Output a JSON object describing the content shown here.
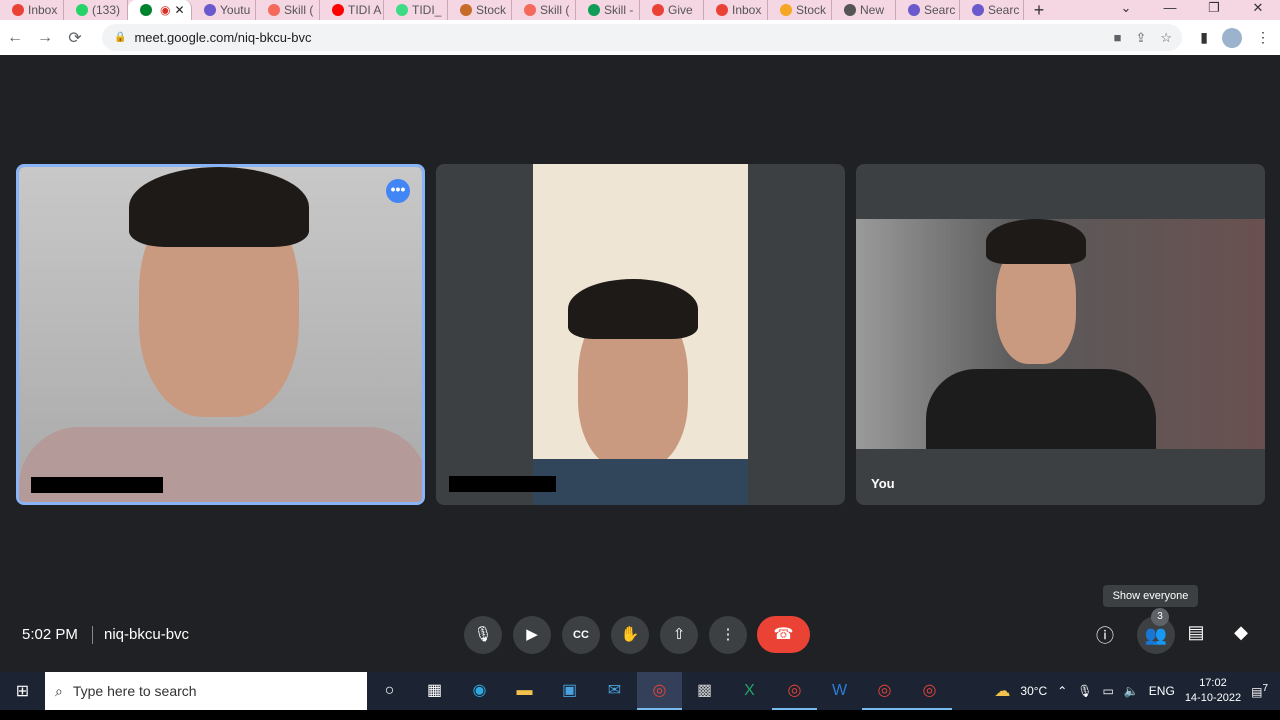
{
  "browser": {
    "tabs": [
      {
        "label": "Inbox",
        "color": "#ea4335"
      },
      {
        "label": "(133)",
        "color": "#25d366"
      },
      {
        "label": "",
        "color": "#00832d",
        "active": true
      },
      {
        "label": "Youtu",
        "color": "#6a5acd"
      },
      {
        "label": "Skill (",
        "color": "#f4695c"
      },
      {
        "label": "TIDI A",
        "color": "#ff0000"
      },
      {
        "label": "TIDI_",
        "color": "#3ddc84"
      },
      {
        "label": "Stock",
        "color": "#c76b29"
      },
      {
        "label": "Skill (",
        "color": "#f4695c"
      },
      {
        "label": "Skill -",
        "color": "#0f9d58"
      },
      {
        "label": "Give",
        "color": "#ea4335"
      },
      {
        "label": "Inbox",
        "color": "#ea4335"
      },
      {
        "label": "Stock",
        "color": "#f5a623"
      },
      {
        "label": "New",
        "color": "#555555"
      },
      {
        "label": "Searc",
        "color": "#6a5acd"
      },
      {
        "label": "Searc",
        "color": "#6a5acd"
      }
    ],
    "url": "meet.google.com/niq-bkcu-bvc"
  },
  "meet": {
    "participants": [
      {
        "name": ""
      },
      {
        "name": ""
      },
      {
        "name": "You"
      }
    ],
    "time": "5:02 PM",
    "meeting_code": "niq-bkcu-bvc",
    "tooltip": "Show everyone",
    "people_count": "3",
    "accent": "#8ab4f8",
    "hangup_color": "#ea4335"
  },
  "taskbar": {
    "search_placeholder": "Type here to search",
    "weather": "30°C",
    "language": "ENG",
    "time": "17:02",
    "date": "14-10-2022",
    "notifications": "7"
  }
}
